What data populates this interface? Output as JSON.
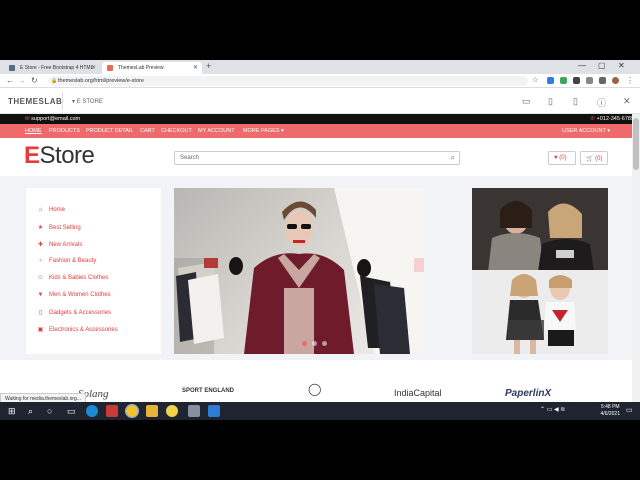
{
  "browser": {
    "tabs": [
      {
        "label": "E Store - Free Bootstrap 4 HTML"
      },
      {
        "label": "ThemesLab Preview"
      }
    ],
    "new_tab": "+",
    "url": "themeslab.org/html/preview/e-store",
    "window_min": "—",
    "window_max": "▢",
    "window_close": "✕"
  },
  "preview_bar": {
    "logo": "THEMESLAB",
    "product": "E STORE",
    "close": "✕"
  },
  "site": {
    "email": "support@email.com",
    "phone": "+012-345-6789",
    "nav": [
      "HOME",
      "PRODUCTS",
      "PRODUCT DETAIL",
      "CART",
      "CHECKOUT",
      "MY ACCOUNT",
      "MORE PAGES ▾"
    ],
    "user_account": "USER ACCOUNT ▾",
    "logo_first": "E",
    "logo_rest": "Store",
    "search_placeholder": "Search",
    "wishlist": "♥ (0)",
    "cart": "🛒 (0)",
    "categories": [
      {
        "icon": "home-icon",
        "glyph": "⌂",
        "label": "Home"
      },
      {
        "icon": "star-icon",
        "glyph": "★",
        "label": "Best Selling"
      },
      {
        "icon": "plus-square-icon",
        "glyph": "✚",
        "label": "New Arrivals"
      },
      {
        "icon": "female-icon",
        "glyph": "♀",
        "label": "Fashion & Beauty"
      },
      {
        "icon": "child-icon",
        "glyph": "☺",
        "label": "Kids & Babies Clothes"
      },
      {
        "icon": "tshirt-icon",
        "glyph": "▼",
        "label": "Men & Women Clothes"
      },
      {
        "icon": "mobile-icon",
        "glyph": "▯",
        "label": "Gadgets & Accessories"
      },
      {
        "icon": "microchip-icon",
        "glyph": "▣",
        "label": "Electronics & Accessories"
      }
    ],
    "brands": [
      "Solang",
      "SPORT ENGLAND",
      "IndiaCapital",
      "PaperlinX"
    ]
  },
  "status_text": "Waiting for media.themeslab.org...",
  "taskbar": {
    "time": "5:48 PM",
    "date": "4/6/2021"
  },
  "colors": {
    "accent": "#ef6a6a",
    "brand_red": "#e53b3b"
  }
}
